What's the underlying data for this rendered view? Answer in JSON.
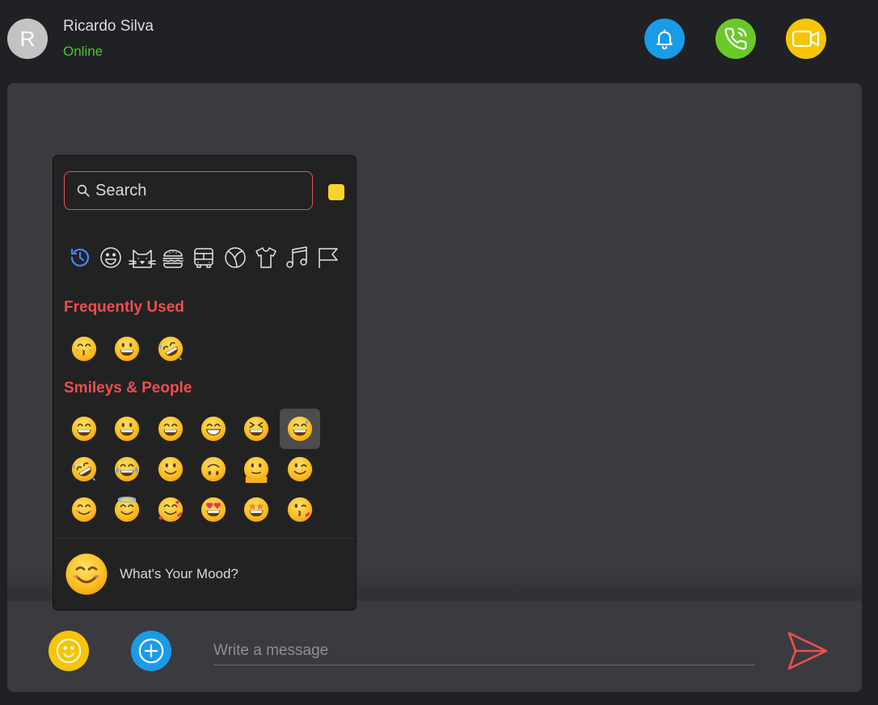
{
  "contact": {
    "initial": "R",
    "name": "Ricardo Silva",
    "status": "Online"
  },
  "header_actions": [
    {
      "icon": "bell-icon",
      "color": "#1a9be8"
    },
    {
      "icon": "phone-icon",
      "color": "#68c928"
    },
    {
      "icon": "video-camera-icon",
      "color": "#f7c505"
    }
  ],
  "picker": {
    "search_placeholder": "Search",
    "skin_tone_color": "#fdd32b",
    "categories": [
      "recent",
      "smileys",
      "animals",
      "food",
      "travel",
      "activities",
      "objects",
      "symbols",
      "flags"
    ],
    "active_category": "recent",
    "sections": {
      "frequently_used": "Frequently Used",
      "smileys_people": "Smileys & People"
    },
    "frequently_used": [
      "kissing-closed-eyes",
      "grinning-big-eyes",
      "rolling-on-floor-laughing"
    ],
    "smileys_people": [
      [
        "grinning",
        "grinning-big-eyes",
        "grinning-smiling-eyes",
        "beaming",
        "squinting-laughing",
        "grinning-sweat"
      ],
      [
        "rolling-on-floor-laughing",
        "tears-of-joy",
        "slightly-smiling",
        "upside-down",
        "melting",
        "winking"
      ],
      [
        "smiling-eyes",
        "halo",
        "smiling-hearts",
        "heart-eyes",
        "star-struck",
        "face-blowing-kiss"
      ]
    ],
    "selected_emoji": "grinning-sweat",
    "footer_text": "What's Your Mood?"
  },
  "composer": {
    "placeholder": "Write a message",
    "accent": "#f04e4e"
  }
}
